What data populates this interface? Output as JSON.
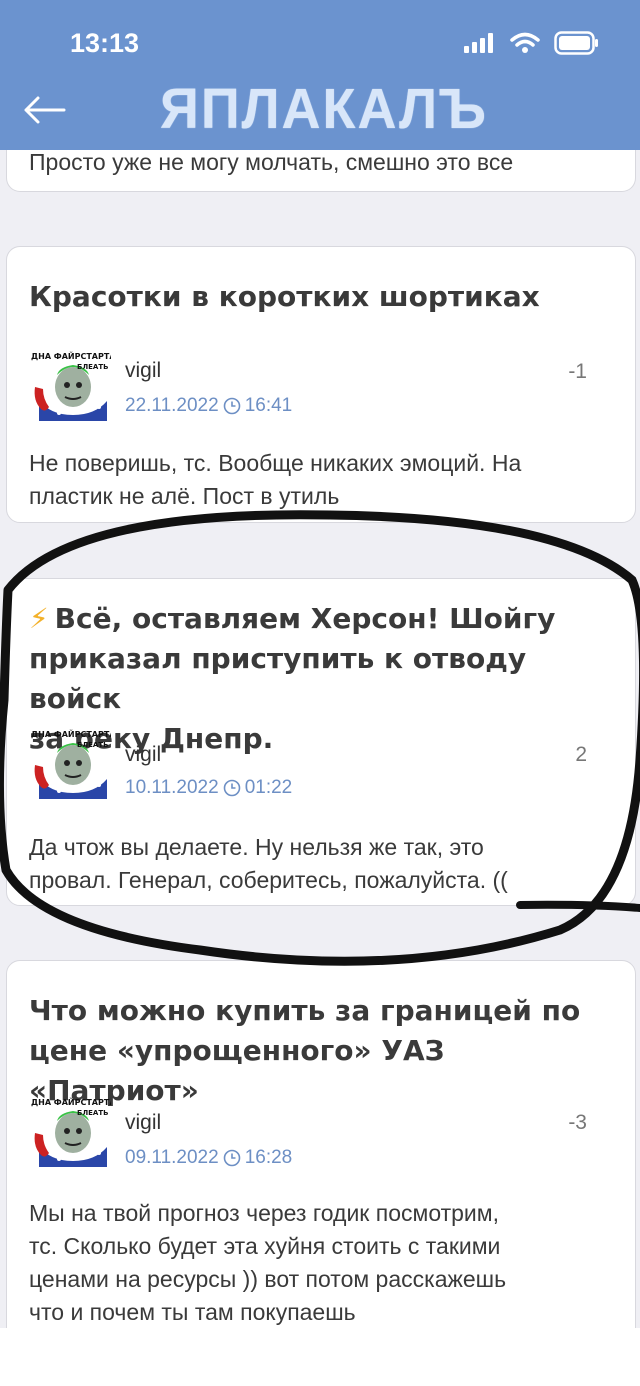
{
  "status_bar": {
    "time": "13:13"
  },
  "header": {
    "logo_text": "ЯПЛАКАЛЪ",
    "back_icon": "arrow-left-icon"
  },
  "colors": {
    "header_bg": "#6b93cf",
    "date_blue": "#6d8fc4",
    "bolt": "#f3b12a"
  },
  "cards": [
    {
      "comment": "Просто уже не могу молчать, смешно это все"
    },
    {
      "title": "Красотки в коротких шортиках",
      "username": "vigil",
      "date": "22.11.2022",
      "time": "16:41",
      "score": "-1",
      "comment_lines": [
        "Не поверишь, тс. Вообще никаких эмоций. На",
        "пластик не алё. Пост в утиль"
      ]
    },
    {
      "title_lines": [
        "Всё, оставляем Херсон! Шойгу",
        "приказал приступить к отводу войск",
        "за реку Днепр."
      ],
      "bolt_icon": "⚡",
      "username": "vigil",
      "date": "10.11.2022",
      "time": "01:22",
      "score": "2",
      "comment_lines": [
        "Да чтож вы делаете.  Ну нельзя же так, это",
        "провал. Генерал, соберитесь, пожалуйста. (("
      ]
    },
    {
      "title_lines": [
        "Что можно купить за границей по",
        "цене «упрощенного» УАЗ «Патриот»"
      ],
      "username": "vigil",
      "date": "09.11.2022",
      "time": "16:28",
      "score": "-3",
      "comment_lines": [
        "Мы на твой прогноз через годик посмотрим,",
        "тс. Сколько будет эта хуйня стоить с такими",
        "ценами на ресурсы )) вот потом расскажешь",
        "что и почем ты там покупаешь"
      ]
    }
  ],
  "avatar_caption": "ДНА ФАЙРСТАРТА, БЛЕАТЬ"
}
